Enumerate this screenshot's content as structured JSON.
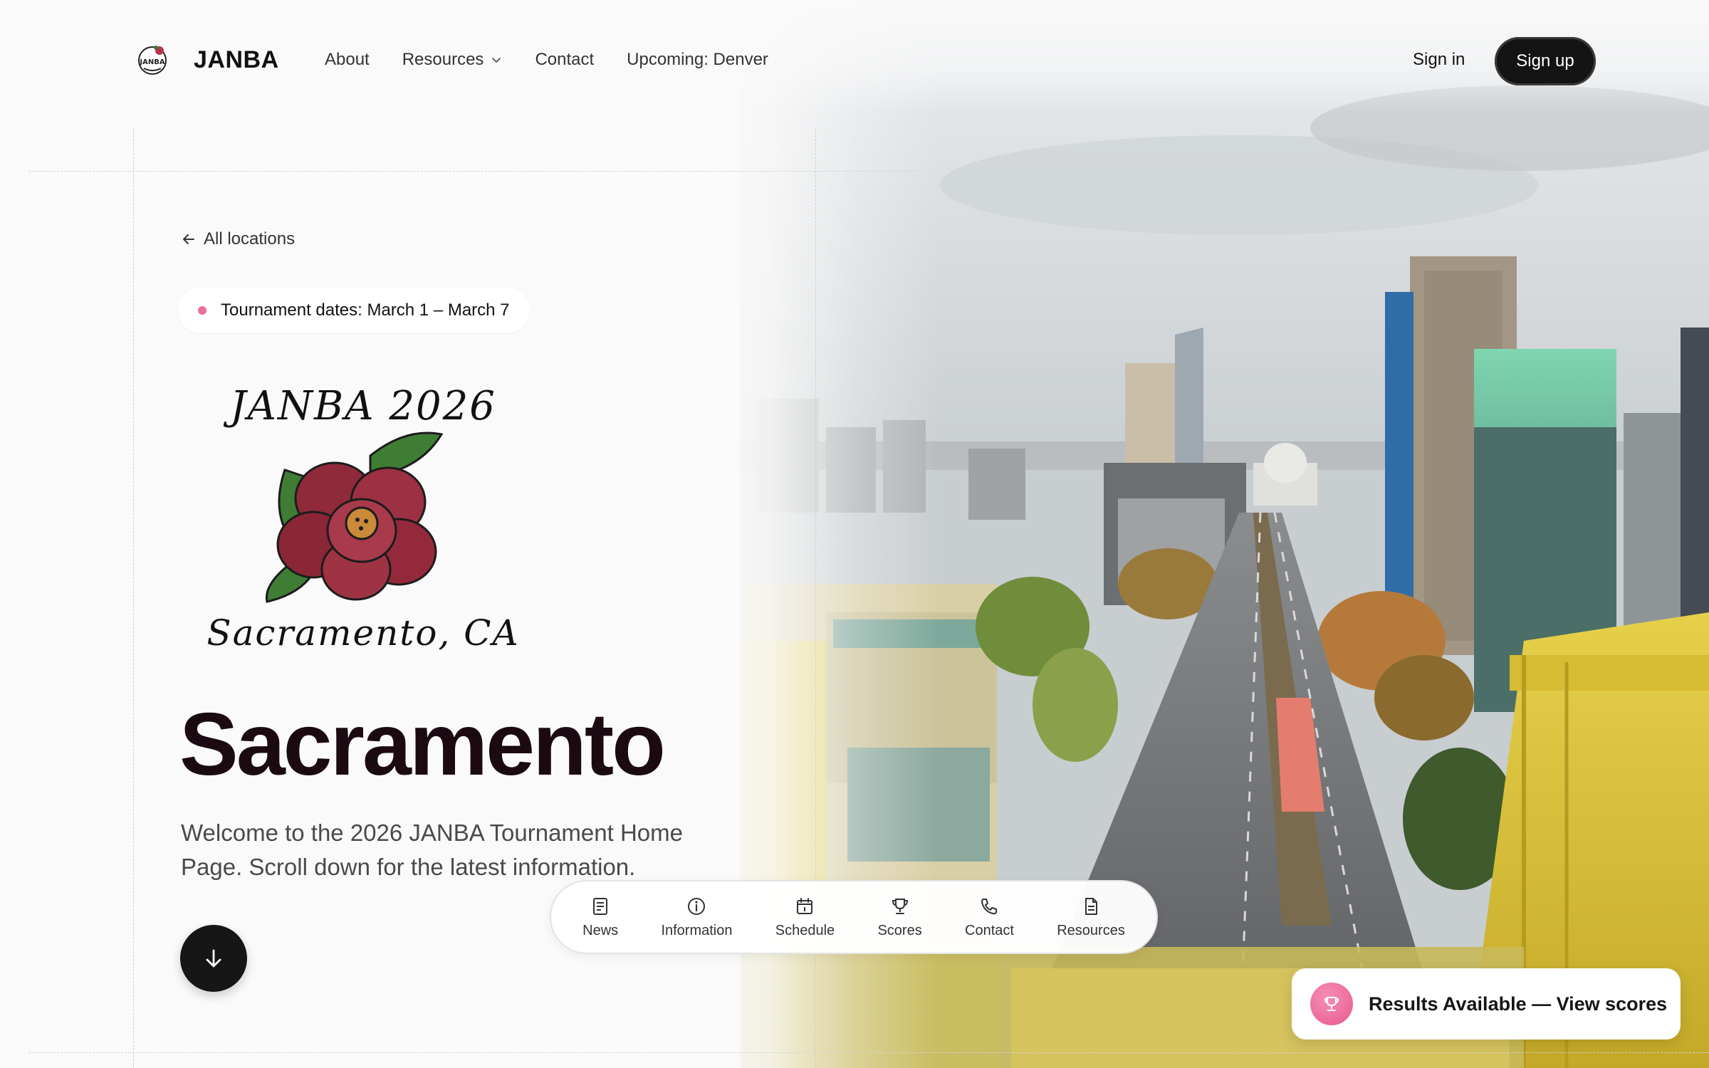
{
  "header": {
    "brand": "JANBA",
    "nav": [
      {
        "label": "About"
      },
      {
        "label": "Resources",
        "has_dropdown": true
      },
      {
        "label": "Contact"
      },
      {
        "label": "Upcoming: Denver"
      }
    ],
    "signin_label": "Sign in",
    "signup_label": "Sign up"
  },
  "hero": {
    "back_link": "All locations",
    "date_pill": "Tournament dates: March 1 – March 7",
    "logo_line1": "JANBA 2026",
    "logo_line2": "Sacramento, CA",
    "title": "Sacramento",
    "welcome": "Welcome to the 2026 JANBA Tournament Home Page. Scroll down for the latest information."
  },
  "dock": {
    "items": [
      {
        "label": "News",
        "icon": "newspaper-icon"
      },
      {
        "label": "Information",
        "icon": "info-icon"
      },
      {
        "label": "Schedule",
        "icon": "calendar-icon"
      },
      {
        "label": "Scores",
        "icon": "trophy-icon"
      },
      {
        "label": "Contact",
        "icon": "phone-icon"
      },
      {
        "label": "Resources",
        "icon": "document-icon"
      }
    ]
  },
  "toast": {
    "text": "Results Available — View scores",
    "icon": "trophy-icon"
  },
  "colors": {
    "accent_pink": "#ec6f98",
    "title_dark": "#1c0a12",
    "button_dark": "#141414"
  }
}
